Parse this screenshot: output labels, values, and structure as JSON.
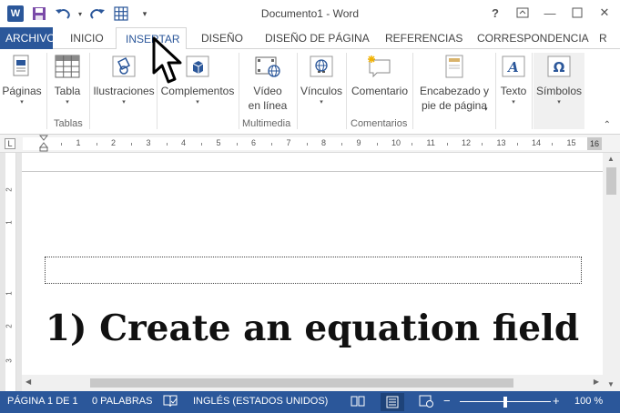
{
  "window": {
    "title": "Documento1 - Word",
    "help": "?",
    "minimize": "—",
    "close": "✕"
  },
  "tabs": [
    {
      "label": "ARCHIVO"
    },
    {
      "label": "INICIO"
    },
    {
      "label": "INSERTAR"
    },
    {
      "label": "DISEÑO"
    },
    {
      "label": "DISEÑO DE PÁGINA"
    },
    {
      "label": "REFERENCIAS"
    },
    {
      "label": "CORRESPONDENCIA"
    },
    {
      "label": "R"
    }
  ],
  "ribbon": {
    "buttons": {
      "pages": "Páginas",
      "table": "Tabla",
      "illustrations": "Ilustraciones",
      "addins": "Complementos",
      "video_line1": "Vídeo",
      "video_line2": "en línea",
      "links": "Vínculos",
      "comment": "Comentario",
      "header_line1": "Encabezado y",
      "header_line2": "pie de página",
      "text": "Texto",
      "symbols": "Símbolos"
    },
    "groups": {
      "tables": "Tablas",
      "multimedia": "Multimedia",
      "comments": "Comentarios"
    },
    "dropdown_arrow": "▾"
  },
  "ruler": {
    "tab_selector": "L",
    "numbers": [
      "1",
      "2",
      "3",
      "4",
      "5",
      "6",
      "7",
      "8",
      "9",
      "10",
      "11",
      "12",
      "13",
      "14",
      "15"
    ],
    "end": "16"
  },
  "vruler": {
    "numbers": [
      "2",
      "1",
      "1",
      "2",
      "3"
    ]
  },
  "document": {
    "caption": "1) Create an equation field"
  },
  "statusbar": {
    "page": "PÁGINA 1 DE 1",
    "words": "0 PALABRAS",
    "language": "INGLÉS (ESTADOS UNIDOS)",
    "zoom_minus": "−",
    "zoom_plus": "+",
    "zoom": "100 %",
    "zoom_level": 0.5
  },
  "colors": {
    "accent": "#2b579a"
  }
}
